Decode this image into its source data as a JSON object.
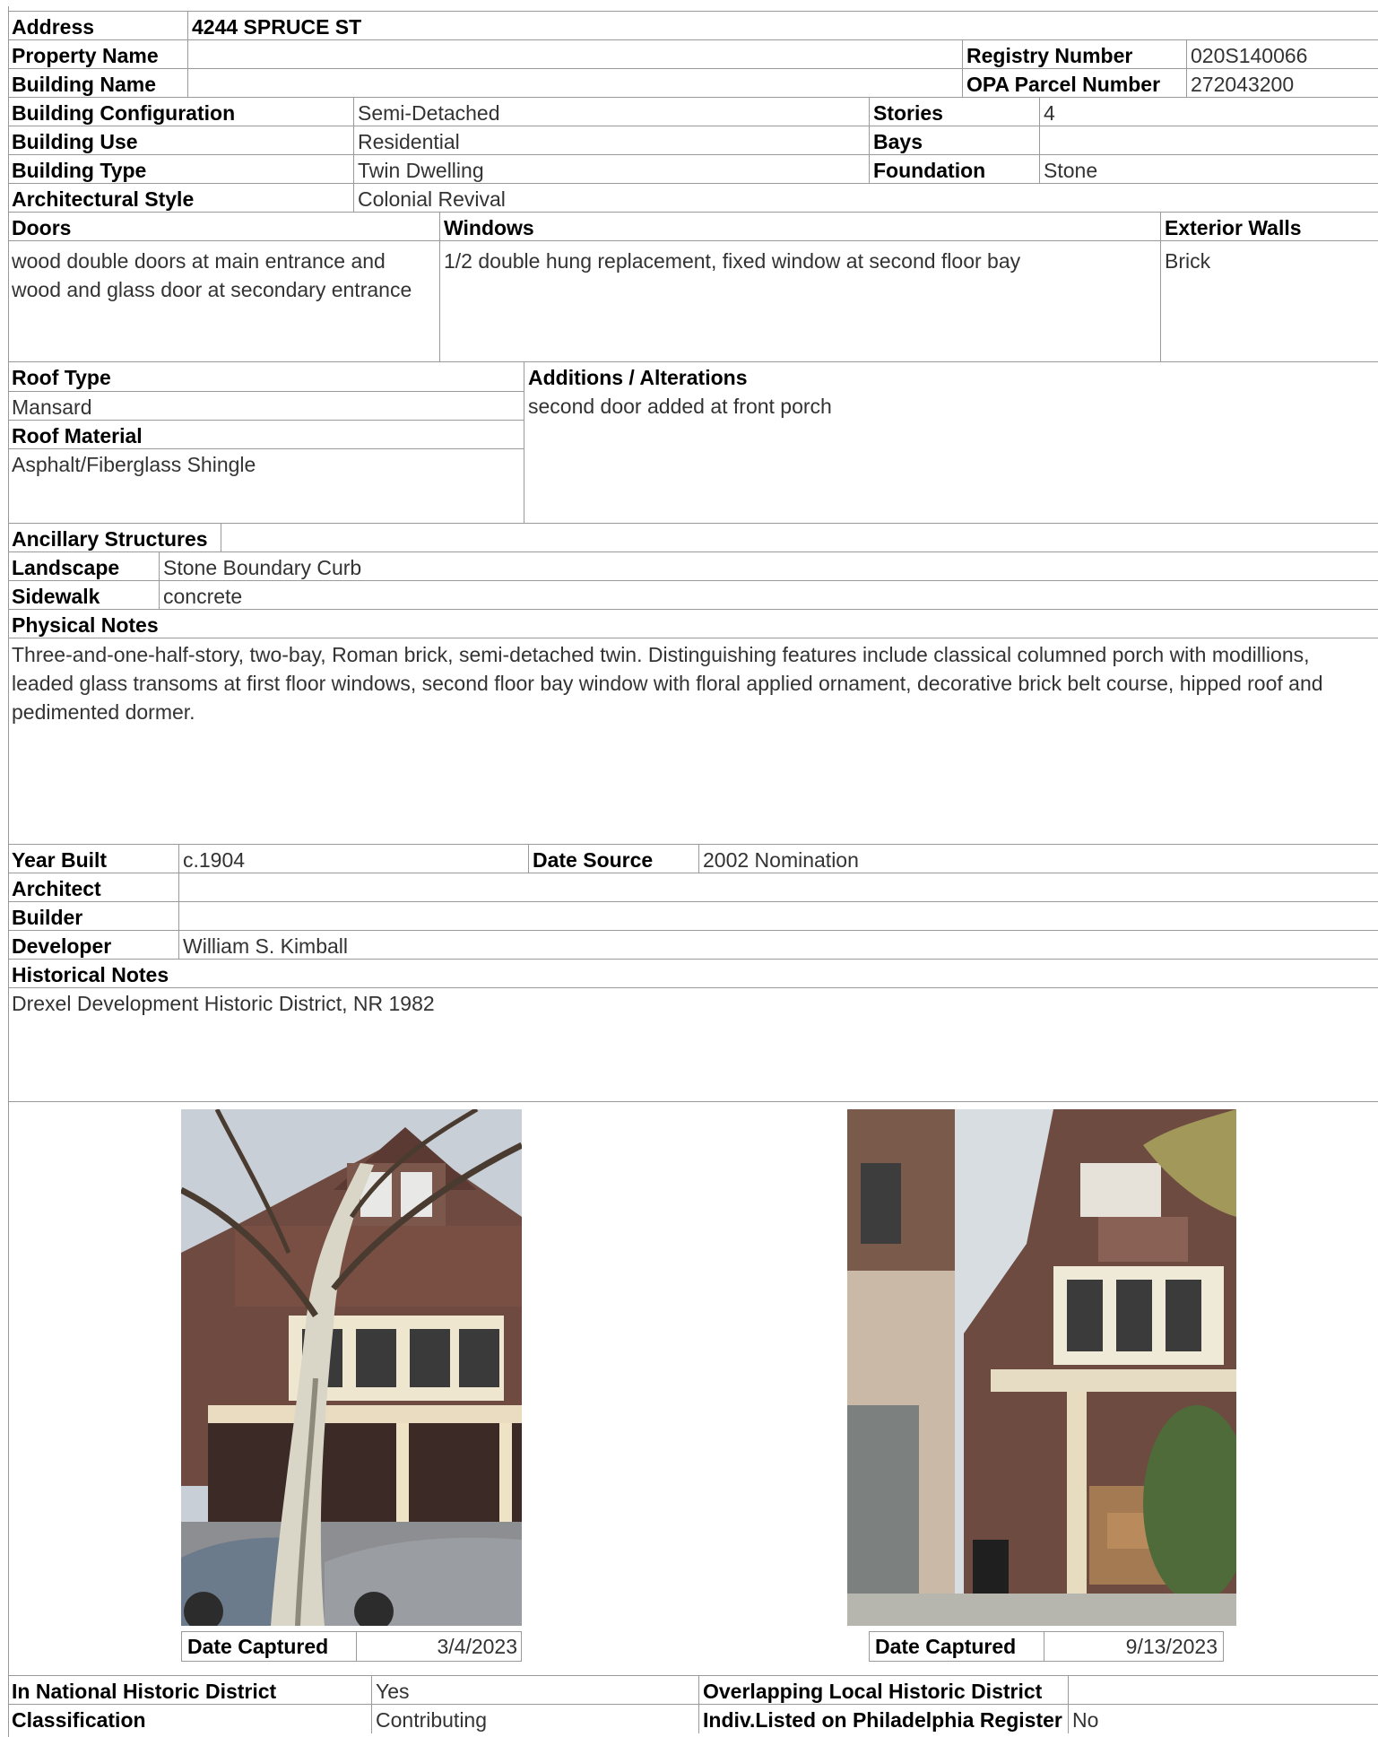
{
  "address": {
    "label": "Address",
    "value": "4244 SPRUCE ST"
  },
  "property_name": {
    "label": "Property Name",
    "value": ""
  },
  "registry_number": {
    "label": "Registry Number",
    "value": "020S140066"
  },
  "building_name": {
    "label": "Building Name",
    "value": ""
  },
  "opa_parcel_number": {
    "label": "OPA Parcel Number",
    "value": "272043200"
  },
  "building_configuration": {
    "label": "Building Configuration",
    "value": "Semi-Detached"
  },
  "stories": {
    "label": "Stories",
    "value": "4"
  },
  "building_use": {
    "label": "Building Use",
    "value": "Residential"
  },
  "bays": {
    "label": "Bays",
    "value": ""
  },
  "building_type": {
    "label": "Building Type",
    "value": "Twin Dwelling"
  },
  "foundation": {
    "label": "Foundation",
    "value": "Stone"
  },
  "architectural_style": {
    "label": "Architectural Style",
    "value": "Colonial Revival"
  },
  "doors": {
    "label": "Doors",
    "value": "wood double doors at main entrance and wood and glass door at secondary entrance"
  },
  "windows": {
    "label": "Windows",
    "value": "1/2 double hung replacement, fixed window at second floor bay"
  },
  "exterior_walls": {
    "label": "Exterior Walls",
    "value": "Brick"
  },
  "roof_type": {
    "label": "Roof Type",
    "value": "Mansard"
  },
  "additions": {
    "label": "Additions / Alterations",
    "value": "second door added at front porch"
  },
  "roof_material": {
    "label": "Roof Material",
    "value": "Asphalt/Fiberglass Shingle"
  },
  "ancillary_structures": {
    "label": "Ancillary Structures",
    "value": ""
  },
  "landscape": {
    "label": "Landscape",
    "value": "Stone Boundary Curb"
  },
  "sidewalk": {
    "label": "Sidewalk",
    "value": "concrete"
  },
  "physical_notes": {
    "label": "Physical Notes",
    "value": "Three-and-one-half-story, two-bay, Roman brick, semi-detached twin. Distinguishing features include classical columned porch with modillions, leaded glass transoms at first floor windows, second floor bay window with floral applied ornament, decorative brick belt course,  hipped roof and pedimented dormer."
  },
  "year_built": {
    "label": "Year Built",
    "value": "c.1904"
  },
  "date_source": {
    "label": "Date Source",
    "value": "2002 Nomination"
  },
  "architect": {
    "label": "Architect",
    "value": ""
  },
  "builder": {
    "label": "Builder",
    "value": ""
  },
  "developer": {
    "label": "Developer",
    "value": "William S. Kimball"
  },
  "historical_notes": {
    "label": "Historical Notes",
    "value": "Drexel Development Historic District, NR 1982"
  },
  "photos": [
    {
      "caption_label": "Date Captured",
      "date": "3/4/2023"
    },
    {
      "caption_label": "Date Captured",
      "date": "9/13/2023"
    }
  ],
  "in_national_historic_district": {
    "label": "In National Historic District",
    "value": "Yes"
  },
  "overlapping_local_district": {
    "label": "Overlapping Local Historic District",
    "value": ""
  },
  "classification": {
    "label": "Classification",
    "value": "Contributing"
  },
  "indiv_listed": {
    "label": "Indiv.Listed on Philadelphia Register",
    "value": "No"
  }
}
